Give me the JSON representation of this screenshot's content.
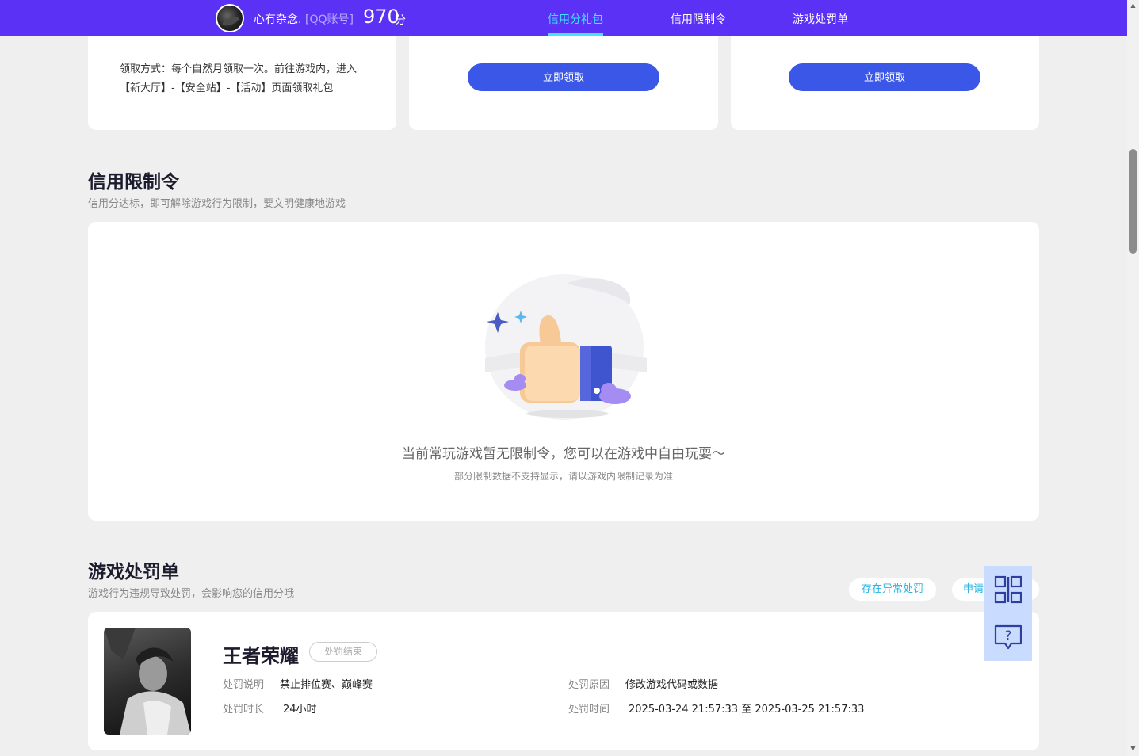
{
  "header": {
    "username": "心冇杂念.",
    "account_type": "[QQ账号]",
    "score": "970",
    "score_unit": "分",
    "nav": [
      {
        "label": "信用分礼包",
        "active": true
      },
      {
        "label": "信用限制令",
        "active": false
      },
      {
        "label": "游戏处罚单",
        "active": false
      }
    ]
  },
  "gift_cards": {
    "claim_method": "领取方式：每个自然月领取一次。前往游戏内，进入【新大厅】-【安全站】-【活动】页面领取礼包",
    "claim_button": "立即领取"
  },
  "restriction": {
    "title": "信用限制令",
    "subtitle": "信用分达标，即可解除游戏行为限制，要文明健康地游戏",
    "empty_main": "当前常玩游戏暂无限制令，您可以在游戏中自由玩耍～",
    "empty_sub": "部分限制数据不支持显示，请以游戏内限制记录为准"
  },
  "penalty": {
    "title": "游戏处罚单",
    "subtitle": "游戏行为违规导致处罚，会影响您的信用分哦",
    "pill_abnormal": "存在异常处罚",
    "pill_apply": "申请",
    "item": {
      "game": "王者荣耀",
      "status": "处罚结束",
      "desc_label": "处罚说明",
      "desc_value": "禁止排位赛、巅峰赛",
      "reason_label": "处罚原因",
      "reason_value": "修改游戏代码或数据",
      "duration_label": "处罚时长",
      "duration_value": "24小时",
      "time_label": "处罚时间",
      "time_value": "2025-03-24 21:57:33 至 2025-03-25 21:57:33"
    }
  },
  "float_panel": {
    "icons": [
      "qr-code-icon",
      "help-chat-icon"
    ]
  },
  "colors": {
    "topbar": "#5b32f5",
    "nav_active": "#3ee6ff",
    "button": "#3a57e8",
    "pill_text": "#29b4e0",
    "float_panel": "#c9dbff"
  }
}
